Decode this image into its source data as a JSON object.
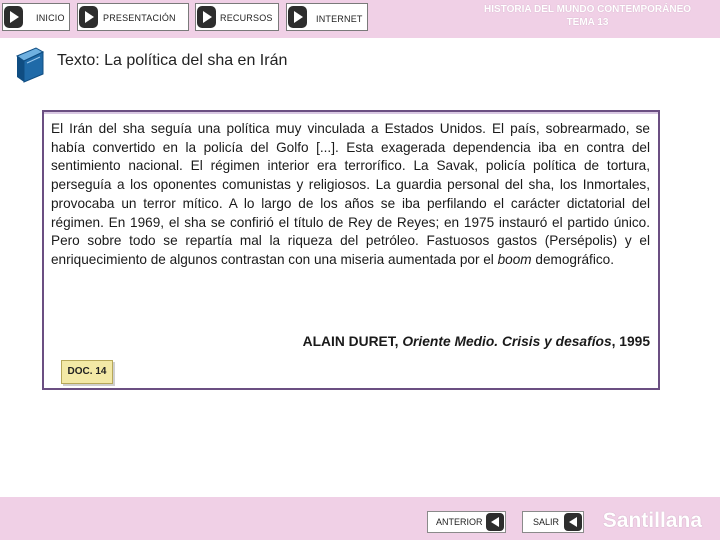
{
  "header": {
    "nav": [
      {
        "label": "INICIO"
      },
      {
        "label": "PRESENTACIÓN"
      },
      {
        "label": "RECURSOS"
      },
      {
        "label": "INTERNET"
      }
    ],
    "title_line1": "HISTORIA DEL MUNDO CONTEMPORÁNEO",
    "title_line2": "TEMA 13"
  },
  "subtitle": "Texto: La política del sha en Irán",
  "document": {
    "text_before": "El Irán del sha seguía una política muy vinculada a Estados Unidos. El país, sobrearmado, se había convertido en la policía del Golfo [...]. Esta exagerada dependencia iba en contra del sentimiento nacional. El régimen interior era terrorífico. La Savak, policía política de tortura, perseguía a los oponentes comunistas y religiosos. La guardia personal del sha, los Inmortales, provocaba un terror mítico. A lo largo de los años se iba perfilando el carácter dictatorial del régimen. En 1969, el sha se confirió el título de Rey de Reyes; en 1975 instauró el partido único. Pero sobre todo se repartía mal la riqueza del petróleo. Fastuosos gastos (Persépolis) y el enriquecimiento de algunos contrastan con una miseria aumentada por el ",
    "text_italic": "boom",
    "text_after": " demográfico.",
    "citation_author": "ALAIN DURET,",
    "citation_title": "Oriente Medio. Crisis y desafíos",
    "citation_year": ", 1995",
    "label": "DOC. 14"
  },
  "footer": {
    "prev_label": "ANTERIOR",
    "exit_label": "SALIR",
    "brand": "Santillana"
  },
  "icons": {
    "nav_button": "play-icon",
    "book": "book-icon",
    "prev": "arrow-left-icon",
    "exit": "arrow-left-icon"
  },
  "colors": {
    "bar_background": "#f0d0e6",
    "frame_border": "#6b4f82",
    "doc_label_background": "#f3e9a6",
    "book_icon": "#1f6aa8"
  }
}
